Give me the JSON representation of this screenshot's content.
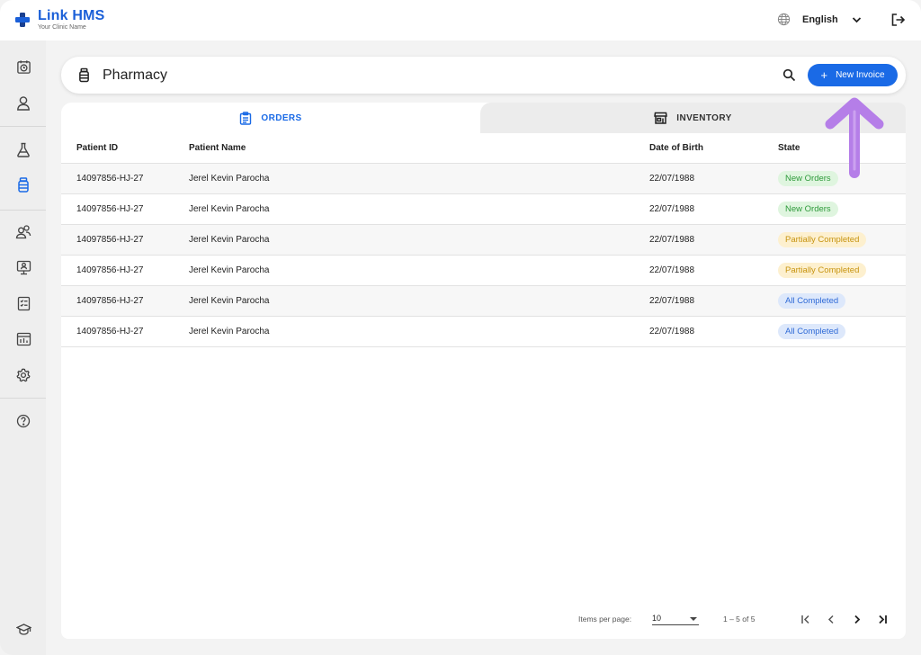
{
  "app": {
    "brand_link": "Link",
    "brand_hms": "HMS",
    "clinic": "Your Clinic Name"
  },
  "topbar": {
    "language": "English"
  },
  "page": {
    "title": "Pharmacy",
    "new_button": "New Invoice"
  },
  "tabs": [
    {
      "label": "ORDERS",
      "active": true
    },
    {
      "label": "INVENTORY",
      "active": false
    }
  ],
  "table": {
    "headers": [
      "Patient ID",
      "Patient Name",
      "Date of Birth",
      "State"
    ],
    "rows": [
      {
        "id": "14097856-HJ-27",
        "name": "Jerel Kevin Parocha",
        "dob": "22/07/1988",
        "state": "New Orders"
      },
      {
        "id": "14097856-HJ-27",
        "name": "Jerel Kevin Parocha",
        "dob": "22/07/1988",
        "state": "New Orders"
      },
      {
        "id": "14097856-HJ-27",
        "name": "Jerel Kevin Parocha",
        "dob": "22/07/1988",
        "state": "Partially Completed"
      },
      {
        "id": "14097856-HJ-27",
        "name": "Jerel Kevin Parocha",
        "dob": "22/07/1988",
        "state": "Partially Completed"
      },
      {
        "id": "14097856-HJ-27",
        "name": "Jerel Kevin Parocha",
        "dob": "22/07/1988",
        "state": "All Completed"
      },
      {
        "id": "14097856-HJ-27",
        "name": "Jerel Kevin Parocha",
        "dob": "22/07/1988",
        "state": "All Completed"
      }
    ]
  },
  "pagination": {
    "items_label": "Items per page:",
    "per_page": "10",
    "range": "1 – 5 of 5"
  },
  "colors": {
    "primary": "#1a6ae6",
    "new": "#2e9a3a",
    "partial": "#c79410",
    "all": "#2f6ad6",
    "annotation": "#b57ee8"
  },
  "icons": {
    "sidebar": [
      "calendar-clock-icon",
      "user-icon",
      "flask-icon",
      "pill-bottle-icon",
      "users-icon",
      "monitor-user-icon",
      "report-icon",
      "dashboard-chart-icon",
      "gear-icon",
      "help-icon",
      "graduation-cap-icon"
    ]
  }
}
